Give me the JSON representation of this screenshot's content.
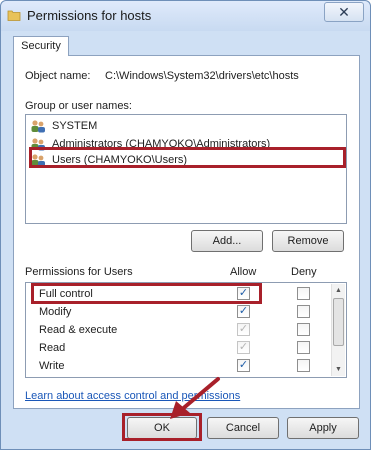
{
  "window": {
    "title": "Permissions for hosts",
    "close_label": "✕"
  },
  "tabs": [
    {
      "label": "Security"
    }
  ],
  "object": {
    "label": "Object name:",
    "value": "C:\\Windows\\System32\\drivers\\etc\\hosts"
  },
  "groups": {
    "label": "Group or user names:",
    "items": [
      {
        "name": "SYSTEM",
        "icon": "users-icon"
      },
      {
        "name": "Administrators (CHAMYOKO\\Administrators)",
        "icon": "users-icon"
      },
      {
        "name": "Users (CHAMYOKO\\Users)",
        "icon": "users-icon",
        "highlighted": true
      }
    ],
    "add_label": "Add...",
    "remove_label": "Remove"
  },
  "permissions": {
    "label": "Permissions for Users",
    "allow_header": "Allow",
    "deny_header": "Deny",
    "rows": [
      {
        "name": "Full control",
        "allow": true,
        "allow_dim": false,
        "deny": false
      },
      {
        "name": "Modify",
        "allow": true,
        "allow_dim": false,
        "deny": false
      },
      {
        "name": "Read & execute",
        "allow": true,
        "allow_dim": true,
        "deny": false
      },
      {
        "name": "Read",
        "allow": true,
        "allow_dim": true,
        "deny": false
      },
      {
        "name": "Write",
        "allow": true,
        "allow_dim": false,
        "deny": false
      }
    ]
  },
  "link_text": "Learn about access control and permissions",
  "buttons": {
    "ok": "OK",
    "cancel": "Cancel",
    "apply": "Apply"
  },
  "colors": {
    "highlight": "#a8202a",
    "frame": "#cfe0f4",
    "link": "#1a57b8"
  }
}
